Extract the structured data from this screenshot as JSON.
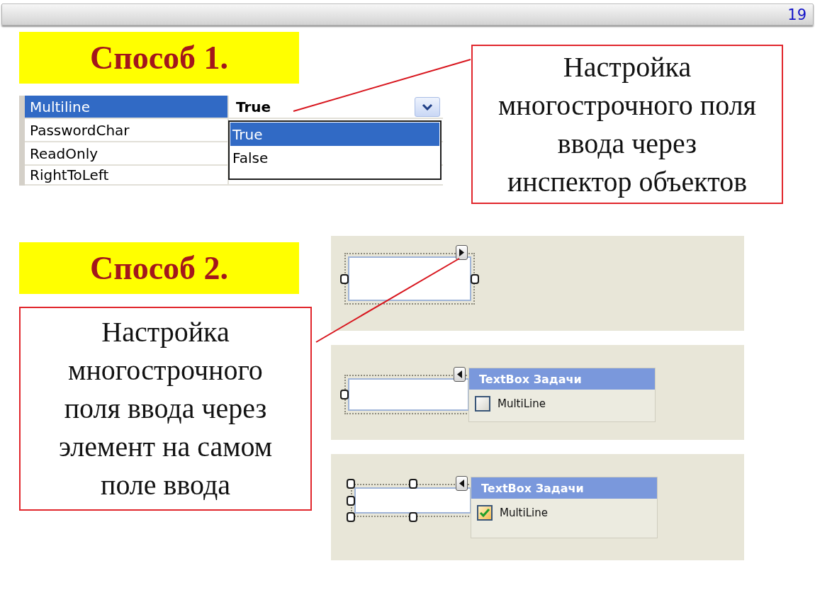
{
  "page_number": "19",
  "method_1": {
    "heading": "Способ 1.",
    "property_grid": {
      "rows": [
        {
          "name": "Multiline",
          "value": "True",
          "selected": true
        },
        {
          "name": "PasswordChar",
          "selected": false
        },
        {
          "name": "ReadOnly",
          "selected": false
        },
        {
          "name": "RightToLeft",
          "selected": false
        }
      ],
      "dropdown": {
        "expanded": true,
        "options": [
          {
            "label": "True",
            "selected": true
          },
          {
            "label": "False",
            "selected": false
          }
        ]
      }
    },
    "callout": "Настройка\nмногострочного поля\nввода через\nинспектор объектов"
  },
  "method_2": {
    "heading": "Способ 2.",
    "callout": "Настройка\nмногострочного\nполя ввода через\nэлемент на самом\nполе ввода",
    "designer_panels": [
      {
        "smart_tag_expanded": false
      },
      {
        "smart_tag_expanded": true,
        "tasks_panel": {
          "title": "TextBox Задачи",
          "option": {
            "label": "MultiLine",
            "checked": false
          }
        }
      },
      {
        "smart_tag_expanded": true,
        "tasks_panel": {
          "title": "TextBox Задачи",
          "option": {
            "label": "MultiLine",
            "checked": true
          }
        }
      }
    ]
  }
}
